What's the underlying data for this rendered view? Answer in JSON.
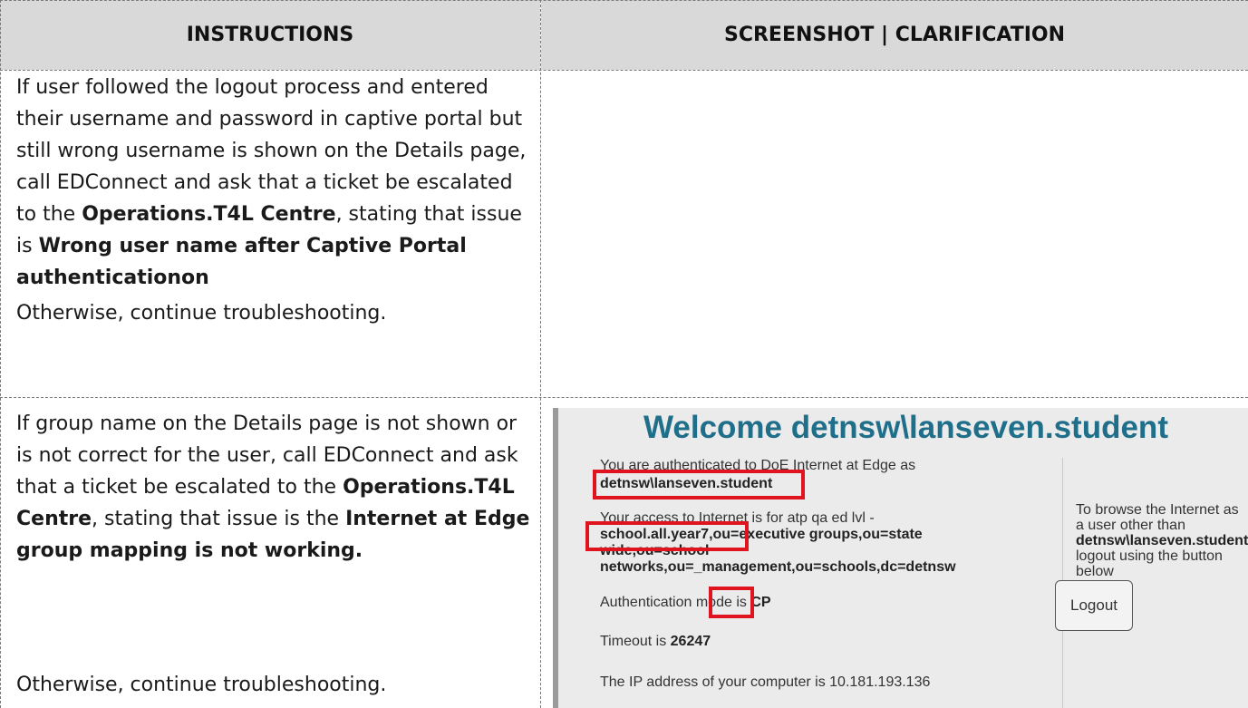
{
  "header": {
    "col1": "INSTRUCTIONS",
    "col2": "SCREENSHOT | CLARIFICATION"
  },
  "row1": {
    "intro": "If user followed the logout process and entered their username and password in captive portal but still wrong username is shown on the Details page, call EDConnect and ask that a ticket be escalated to the",
    "team": "Operations.T4L Centre",
    "mid": ", stating that issue is",
    "issue": "Wrong user name after Captive Portal authenticationon",
    "otherwise": "Otherwise, continue troubleshooting."
  },
  "row2": {
    "intro": "If group name on the Details page is not shown or is not correct for the user, call EDConnect and ask that a ticket be escalated to the",
    "team": "Operations.T4L Centre",
    "mid": ", stating that issue is the",
    "issue": "Internet at Edge group mapping is not working.",
    "otherwise": "Otherwise, continue troubleshooting."
  },
  "screenshot": {
    "welcome_prefix": "Welcome",
    "welcome_user": "detnsw\\lanseven.student",
    "auth_line": "You are authenticated to DoE Internet at Edge as",
    "auth_user": "detnsw\\lanseven.student",
    "access_line1": "Your access to Internet is for atp qa ed lvl -",
    "access_line2": "school.all.year7,ou=executive groups,ou=state",
    "access_line3": "wide,ou=school",
    "access_line4": "networks,ou=_management,ou=schools,dc=detnsw",
    "auth_mode_label": "Authentication mode is",
    "auth_mode_value": "CP",
    "timeout_label": "Timeout is",
    "timeout_value": "26247",
    "ip_line": "The IP address of your computer is 10.181.193.136",
    "side_line1": "To browse the Internet as",
    "side_line2": "a user other than",
    "side_line3": "detnsw\\lanseven.student,",
    "side_line4": "logout using the button",
    "side_line5": "below",
    "logout_button": "Logout"
  }
}
